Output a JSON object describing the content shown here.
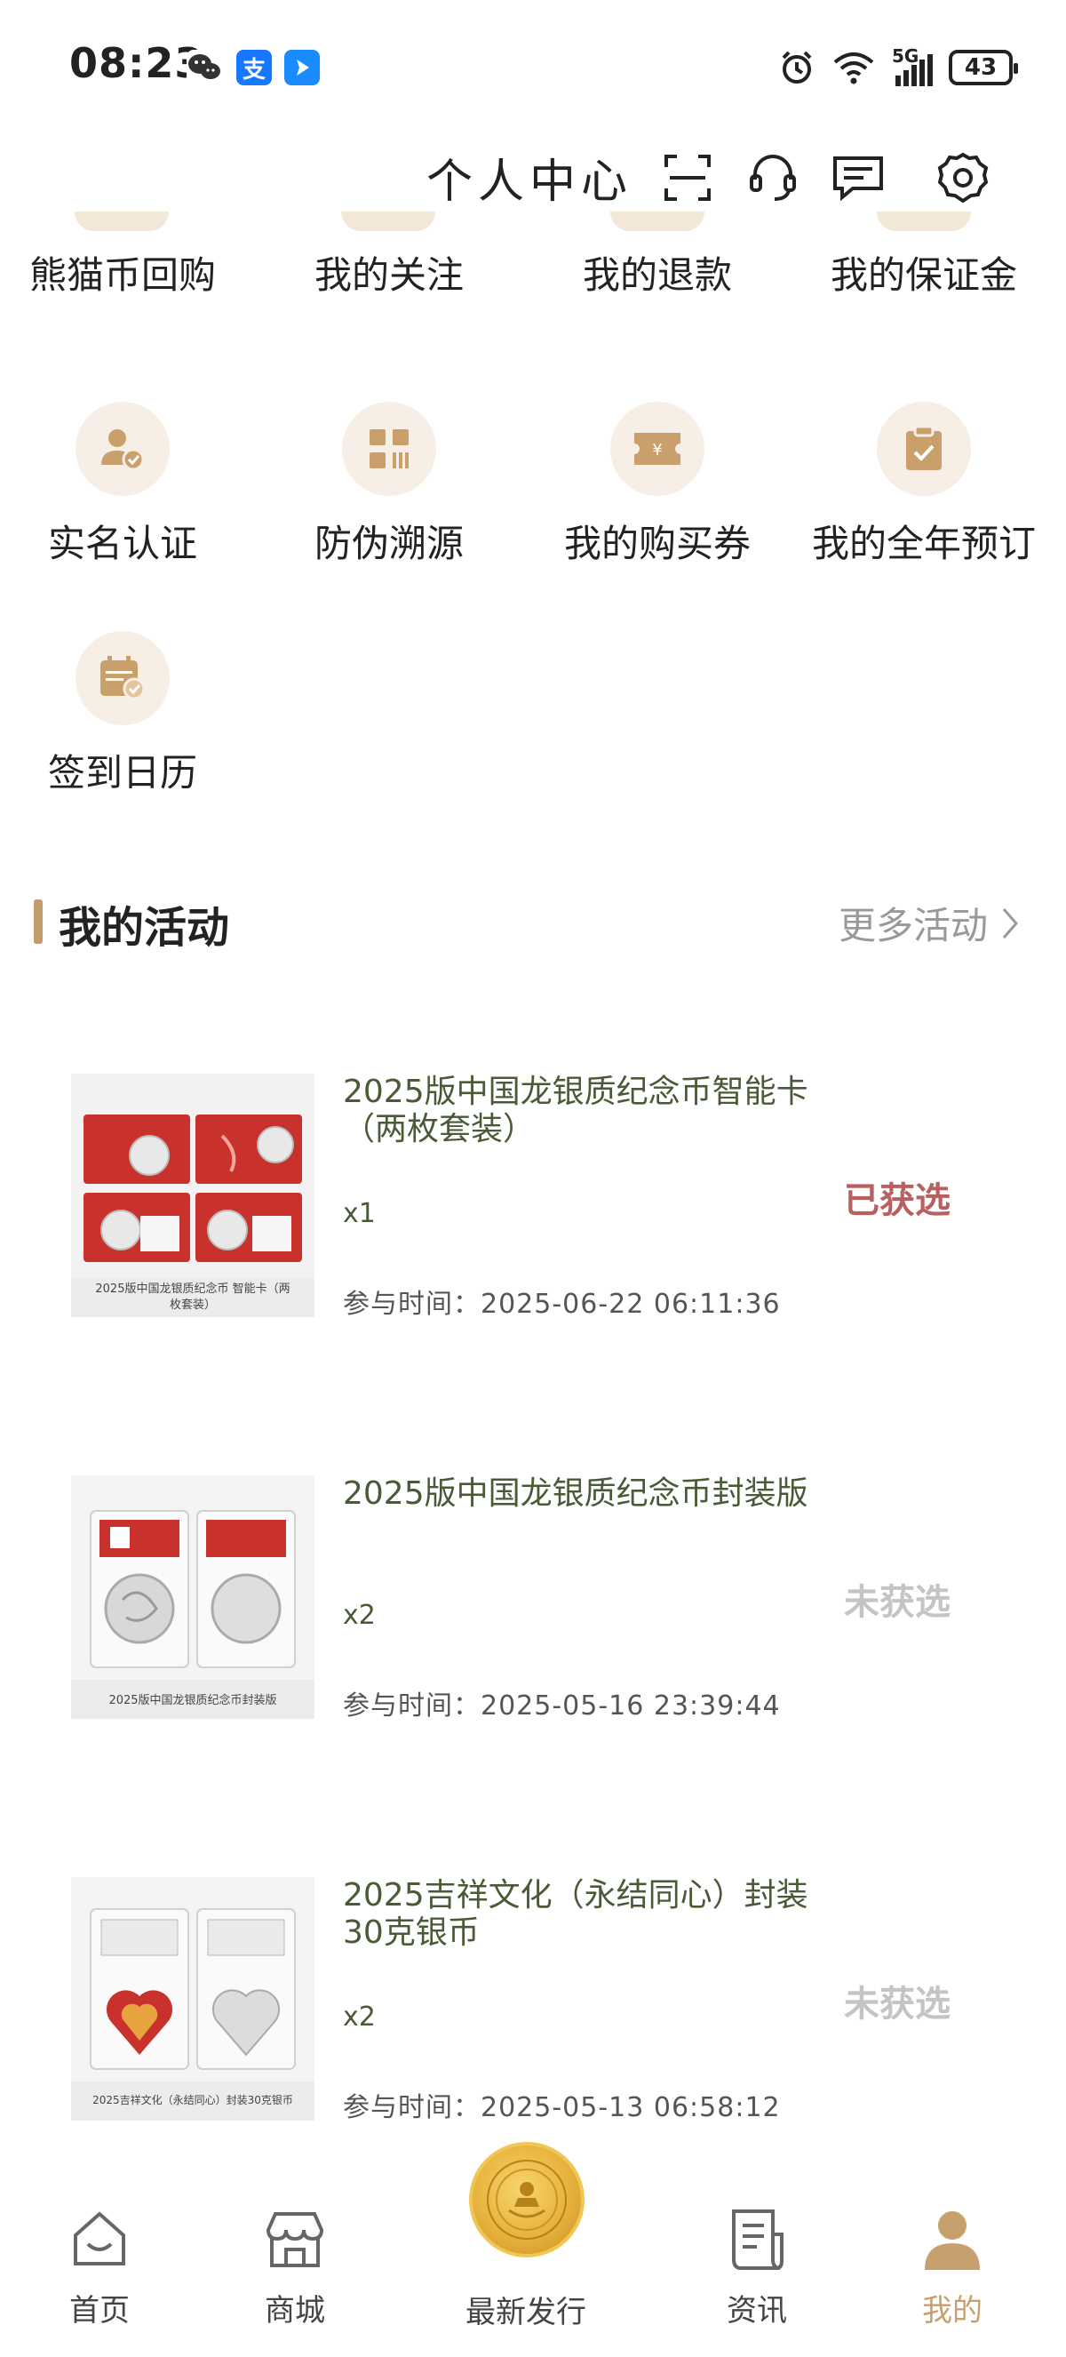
{
  "status_bar": {
    "time": "08:23",
    "network": "5G",
    "battery": "43",
    "app_icons": [
      "wechat-icon",
      "alipay-icon",
      "message-app-icon"
    ]
  },
  "header": {
    "title": "个人中心",
    "icons": [
      "scan-icon",
      "customer-service-icon",
      "message-icon",
      "settings-icon"
    ]
  },
  "grid_row0": [
    {
      "label": "熊猫币回购"
    },
    {
      "label": "我的关注"
    },
    {
      "label": "我的退款"
    },
    {
      "label": "我的保证金"
    }
  ],
  "grid_row1": [
    {
      "label": "实名认证",
      "icon": "verified-user-icon"
    },
    {
      "label": "防伪溯源",
      "icon": "anti-counterfeit-icon"
    },
    {
      "label": "我的购买券",
      "icon": "coupon-icon"
    },
    {
      "label": "我的全年预订",
      "icon": "clipboard-check-icon"
    }
  ],
  "grid_row2": [
    {
      "label": "签到日历",
      "icon": "calendar-check-icon"
    }
  ],
  "section": {
    "title": "我的活动",
    "more": "更多活动"
  },
  "activities": [
    {
      "title": "2025版中国龙银质纪念币智能卡（两枚套装）",
      "qty": "x1",
      "time": "参与时间：2025-06-22 06:11:36",
      "status": "已获选",
      "status_color": "#b85f5f",
      "image_caption": "2025版中国龙银质纪念币 智能卡（两枚套装）"
    },
    {
      "title": "2025版中国龙银质纪念币封装版",
      "qty": "x2",
      "time": "参与时间：2025-05-16 23:39:44",
      "status": "未获选",
      "status_color": "#c4c4c4",
      "image_caption": "2025版中国龙银质纪念币封装版"
    },
    {
      "title": "2025吉祥文化（永结同心）封装30克银币",
      "qty": "x2",
      "time": "参与时间：2025-05-13 06:58:12",
      "status": "未获选",
      "status_color": "#c4c4c4",
      "image_caption": "2025吉祥文化（永结同心）封装30克银币"
    }
  ],
  "bottom_nav": [
    {
      "label": "首页",
      "icon": "home-icon"
    },
    {
      "label": "商城",
      "icon": "store-icon"
    },
    {
      "label": "最新发行",
      "icon": "coin-icon"
    },
    {
      "label": "资讯",
      "icon": "news-icon"
    },
    {
      "label": "我的",
      "icon": "profile-icon",
      "active": true
    }
  ],
  "colors": {
    "accent": "#c39a6a",
    "icon_bg": "#f7efe6",
    "selected": "#b85f5f",
    "not_selected": "#c4c4c4",
    "nav_active": "#c8a06e"
  }
}
